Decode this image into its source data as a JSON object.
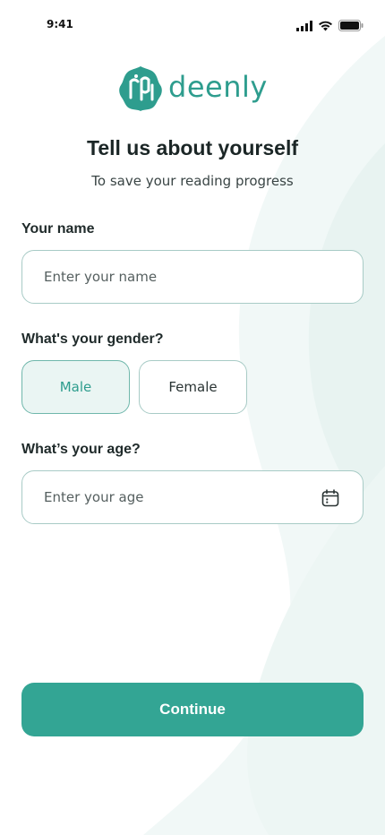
{
  "status_bar": {
    "time": "9:41"
  },
  "brand": {
    "name": "deenly",
    "color": "#2e9d8e"
  },
  "header": {
    "title": "Tell us about yourself",
    "subtitle": "To save your reading progress"
  },
  "form": {
    "name": {
      "label": "Your name",
      "placeholder": "Enter your name"
    },
    "gender": {
      "label": "What's your gender?",
      "options": [
        "Male",
        "Female"
      ],
      "selected": "Male"
    },
    "age": {
      "label": "What’s your age?",
      "placeholder": "Enter your age",
      "icon": "calendar-icon"
    }
  },
  "actions": {
    "continue_label": "Continue",
    "accent": "#33a594"
  }
}
